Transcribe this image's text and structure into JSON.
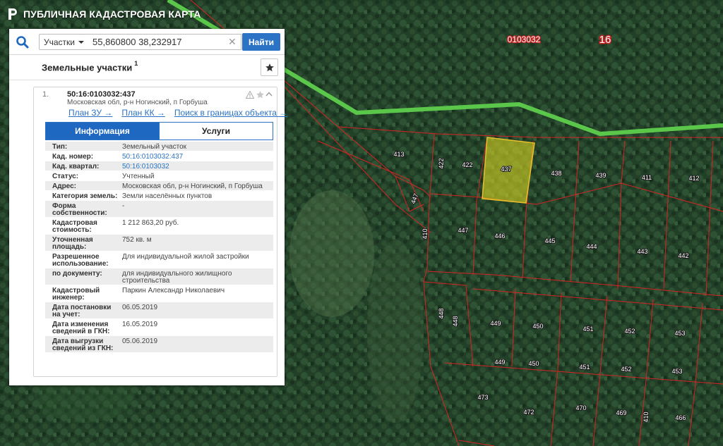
{
  "app": {
    "title": "ПУБЛИЧНАЯ КАДАСТРОВАЯ КАРТА",
    "logo_icon": "rosreestr-logo-icon"
  },
  "search": {
    "type_label": "Участки",
    "query": "55,860800 38,232917",
    "find_label": "Найти"
  },
  "results": {
    "title": "Земельные участки",
    "count": "1"
  },
  "card": {
    "index": "1.",
    "cad_number": "50:16:0103032:437",
    "address": "Московская обл, р-н Ногинский, п Горбуша",
    "links": [
      "План ЗУ →",
      "План КК →",
      "Поиск в границах объекта →"
    ],
    "tabs": [
      "Информация",
      "Услуги"
    ],
    "properties": [
      {
        "label": "Тип:",
        "value": "Земельный участок"
      },
      {
        "label": "Кад. номер:",
        "value": "50:16:0103032:437",
        "link": true
      },
      {
        "label": "Кад. квартал:",
        "value": "50:16:0103032",
        "link": true
      },
      {
        "label": "Статус:",
        "value": "Учтенный"
      },
      {
        "label": "Адрес:",
        "value": "Московская обл, р-н Ногинский, п Горбуша"
      },
      {
        "label": "Категория земель:",
        "value": "Земли населённых пунктов"
      },
      {
        "label": "Форма собственности:",
        "value": "-"
      },
      {
        "label": "Кадастровая стоимость:",
        "value": "1 212 863,20 руб."
      },
      {
        "label": "Уточненная площадь:",
        "value": "752 кв. м"
      },
      {
        "label": "Разрешенное использование:",
        "value": "Для индивидуальной жилой застройки"
      },
      {
        "label": "по документу:",
        "value": "для индивидуального жилищного строительства"
      },
      {
        "label": "Кадастровый инженер:",
        "value": "Паркин Александр Николаевич"
      },
      {
        "label": "Дата постановки на учет:",
        "value": "06.05.2019"
      },
      {
        "label": "Дата изменения сведений в ГКН:",
        "value": "16.05.2019"
      },
      {
        "label": "Дата выгрузки сведений из ГКН:",
        "value": "05.06.2019"
      }
    ]
  },
  "map": {
    "quarter_label": "0103032",
    "zone_label": "16",
    "parcel_labels": [
      "413",
      "422",
      "422",
      "437",
      "438",
      "439",
      "411",
      "412",
      "447",
      "447",
      "410",
      "446",
      "445",
      "444",
      "443",
      "442",
      "448",
      "448",
      "449",
      "450",
      "451",
      "452",
      "453",
      "449",
      "450",
      "451",
      "452",
      "453",
      "473",
      "472",
      "470",
      "469",
      "466",
      "410"
    ],
    "colors": {
      "parcel_border": "#d62424",
      "boundary_green": "#5ac74a",
      "selected_fill": "#d7d623"
    }
  }
}
